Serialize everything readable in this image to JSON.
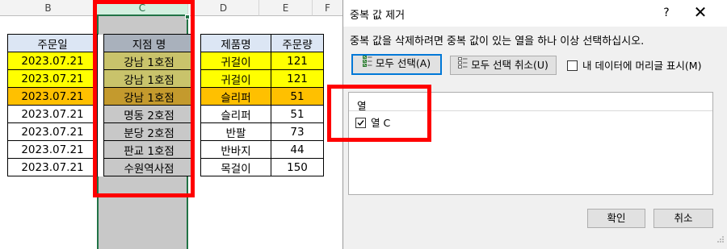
{
  "sheet": {
    "columns": [
      "B",
      "C",
      "D",
      "E",
      "F"
    ],
    "headers": [
      "주문일",
      "지점 명",
      "제품명",
      "주문량"
    ],
    "rows": [
      [
        "2023.07.21",
        "강남 1호점",
        "귀걸이",
        "121"
      ],
      [
        "2023.07.21",
        "강남 1호점",
        "귀걸이",
        "121"
      ],
      [
        "2023.07.21",
        "강남 1호점",
        "슬리퍼",
        "51"
      ],
      [
        "2023.07.21",
        "명동 2호점",
        "슬리퍼",
        "51"
      ],
      [
        "2023.07.21",
        "분당 2호점",
        "반팔",
        "73"
      ],
      [
        "2023.07.21",
        "판교 1호점",
        "반바지",
        "44"
      ],
      [
        "2023.07.21",
        "수원역사점",
        "목걸이",
        "150"
      ]
    ],
    "row_highlights": [
      "yellow",
      "yellow",
      "orange",
      "none",
      "none",
      "none",
      "none"
    ],
    "colors": {
      "header_fill": "#dce6f4",
      "yellow": "#ffff00",
      "orange": "#ffc000",
      "selection_gray": "#c8c8c8",
      "excel_green": "#217346",
      "annotation_red": "#ff0000"
    }
  },
  "dialog": {
    "title": "중복 값 제거",
    "help": "?",
    "close": "✕",
    "description": "중복 값을 삭제하려면 중복 값이 있는 열을 하나 이상 선택하십시오.",
    "select_all": "모두 선택(A)",
    "unselect_all": "모두 선택 취소(U)",
    "headers_checkbox": "내 데이터에 머리글 표시(M)",
    "headers_checked": false,
    "list_header": "열",
    "list_items": [
      {
        "label": "열 C",
        "checked": true
      }
    ],
    "ok": "확인",
    "cancel": "취소"
  }
}
